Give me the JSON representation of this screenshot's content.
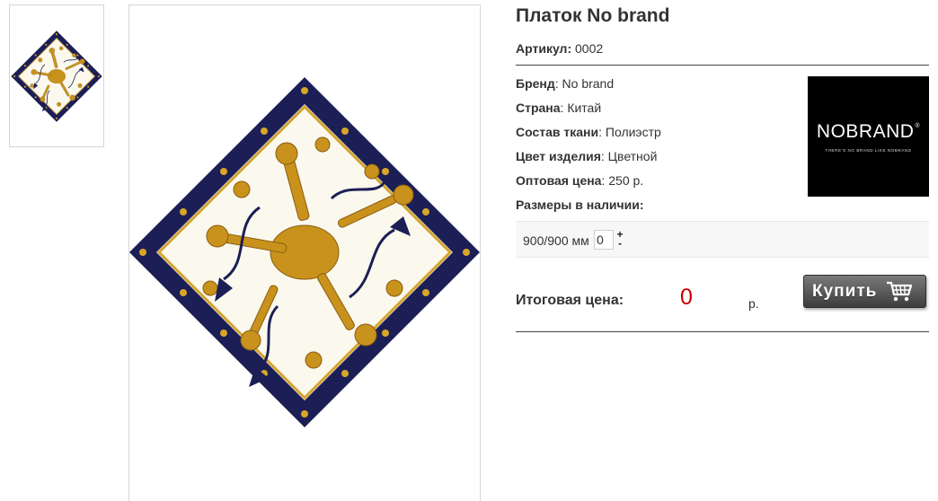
{
  "product": {
    "title": "Платок No brand",
    "article_label": "Артикул:",
    "article_value": "0002",
    "attributes": [
      {
        "label": "Бренд",
        "value": ": No brand"
      },
      {
        "label": "Страна",
        "value": ": Китай"
      },
      {
        "label": "Состав ткани",
        "value": ": Полиэстр"
      },
      {
        "label": "Цвет изделия",
        "value": ": Цветной"
      },
      {
        "label": "Оптовая цена",
        "value": ": 250 р."
      }
    ],
    "sizes_heading": "Размеры в наличии:",
    "sizes": [
      {
        "label": "900/900 мм",
        "quantity": "0"
      }
    ],
    "qty_plus": "+",
    "qty_minus": "-"
  },
  "brand_logo": {
    "word": "NOBRAND",
    "mark": "®",
    "tagline": "THERE'S NO BRAND LIKE NOBRAND"
  },
  "total": {
    "label": "Итоговая цена:",
    "value": "0",
    "currency": "р."
  },
  "buy_button": {
    "label": "Купить",
    "icon": "cart-icon"
  },
  "images": {
    "thumbnail": "scarf-thumbnail",
    "main": "scarf-main-image"
  },
  "colors": {
    "scarf_navy": "#1c1f55",
    "scarf_gold": "#c8921c",
    "scarf_cream": "#fbf8ee",
    "price_red": "#cc0000",
    "button_dark": "#3d3d3d"
  }
}
